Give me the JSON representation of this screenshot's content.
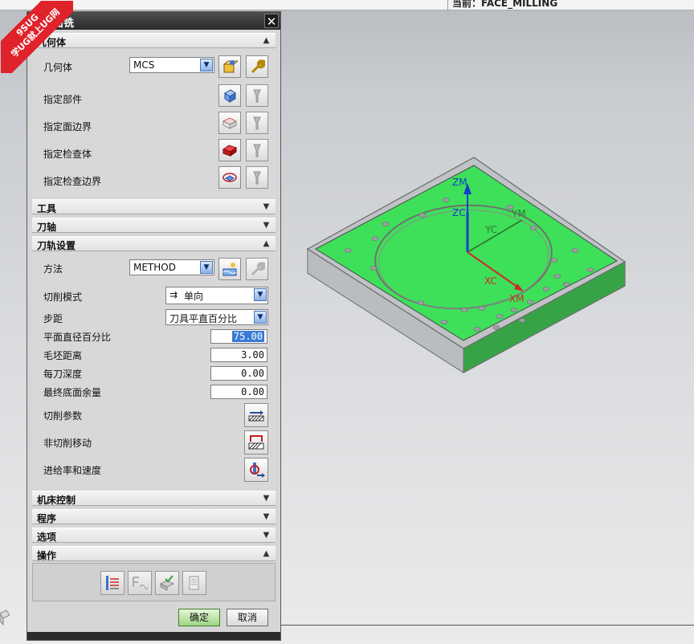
{
  "status_bar": {
    "current_text": "当前：FACE_MILLING"
  },
  "watermark": {
    "line1": "9SUG",
    "line2": "学UG就上UG网"
  },
  "dialog": {
    "title": "面铣",
    "close_glyph": "✕",
    "sections": {
      "geometry": {
        "header": "几何体",
        "chevron": "up",
        "geometry_label": "几何体",
        "geometry_value": "MCS",
        "specify_part": "指定部件",
        "specify_face_boundary": "指定面边界",
        "specify_check_body": "指定检查体",
        "specify_check_boundary": "指定检查边界"
      },
      "tool": {
        "header": "工具",
        "chevron": "down"
      },
      "tool_axis": {
        "header": "刀轴",
        "chevron": "down"
      },
      "path_settings": {
        "header": "刀轨设置",
        "chevron": "up",
        "method_label": "方法",
        "method_value": "METHOD",
        "cut_pattern_label": "切削模式",
        "cut_pattern_value": "单向",
        "stepover_label": "步距",
        "stepover_value": "刀具平直百分比",
        "flat_diameter_label": "平面直径百分比",
        "flat_diameter_value": "75.00",
        "blank_distance_label": "毛坯距离",
        "blank_distance_value": "3.00",
        "depth_per_cut_label": "每刀深度",
        "depth_per_cut_value": "0.00",
        "final_floor_stock_label": "最终底面余量",
        "final_floor_stock_value": "0.00",
        "cutting_params_label": "切削参数",
        "non_cutting_label": "非切削移动",
        "feeds_speeds_label": "进给率和速度"
      },
      "machine_control": {
        "header": "机床控制",
        "chevron": "down"
      },
      "program": {
        "header": "程序",
        "chevron": "down"
      },
      "options": {
        "header": "选项",
        "chevron": "down"
      },
      "actions": {
        "header": "操作",
        "chevron": "up"
      }
    },
    "buttons": {
      "ok": "确定",
      "cancel": "取消"
    }
  },
  "viewport": {
    "axes": {
      "zm": "ZM",
      "zc": "ZC",
      "ym": "YM",
      "yc": "YC",
      "xc": "XC",
      "xm": "XM"
    },
    "colors": {
      "face": "#3ee05a",
      "side": "#2e9e3c",
      "edge": "#7a7a7a",
      "zaxis": "#1340c8",
      "xaxis": "#d0282a",
      "yaxis": "#2f7a2f"
    }
  },
  "icons": [
    "tool-geometry-icon",
    "wrench-icon",
    "part-icon",
    "face-boundary-icon",
    "check-body-icon",
    "check-boundary-icon",
    "display-icon",
    "method-icon",
    "cut-params-icon",
    "non-cut-move-icon",
    "feeds-speeds-icon",
    "generate-icon",
    "replay-icon",
    "verify-icon",
    "list-icon"
  ]
}
